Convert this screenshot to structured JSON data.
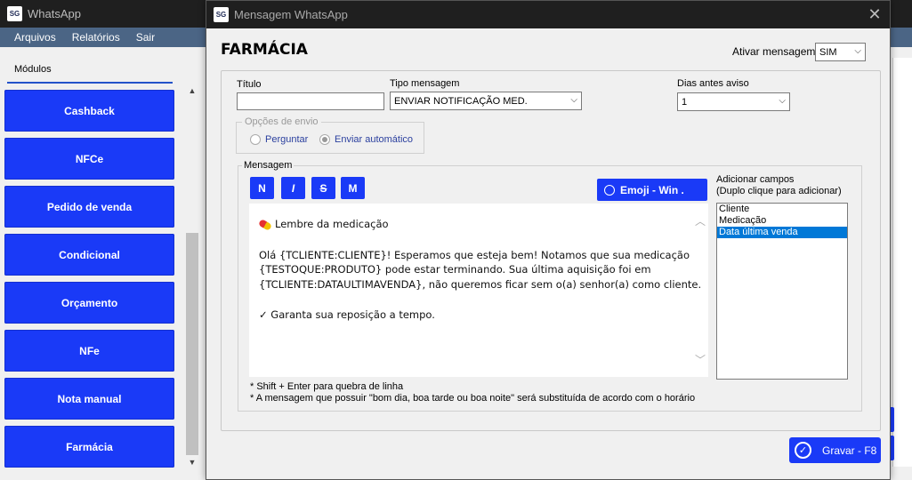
{
  "main_window": {
    "logo": "SG",
    "title": "WhatsApp",
    "menu": [
      "Arquivos",
      "Relatórios",
      "Sair"
    ],
    "modules_tab": "Módulos",
    "modules": [
      "Cashback",
      "NFCe",
      "Pedido de venda",
      "Condicional",
      "Orçamento",
      "NFe",
      "Nota manual",
      "Farmácia"
    ]
  },
  "dialog": {
    "logo": "SG",
    "title": "Mensagem WhatsApp",
    "heading": "FARMÁCIA",
    "ativar_label": "Ativar mensagem",
    "ativar_value": "SIM",
    "titulo_label": "Título",
    "titulo_value": "",
    "tipo_label": "Tipo mensagem",
    "tipo_value": "ENVIAR NOTIFICAÇÃO MED.",
    "dias_label": "Dias antes aviso",
    "dias_value": "1",
    "opcoes_legend": "Opções de envio",
    "opcao_perguntar": "Perguntar",
    "opcao_enviar": "Enviar automático",
    "mensagem_legend": "Mensagem",
    "fmt_buttons": [
      "N",
      "I",
      "S",
      "M"
    ],
    "emoji_button": "Emoji - Win .",
    "message_lines": [
      "Lembre da medicação",
      "Olá {TCLIENTE:CLIENTE}! Esperamos que esteja bem! Notamos que sua medicação",
      "{TESTOQUE:PRODUTO} pode estar terminando. Sua última aquisição foi em",
      "{TCLIENTE:DATAULTIMAVENDA}, não queremos ficar sem o(a) senhor(a) como cliente.",
      "✓ Garanta sua reposição a tempo."
    ],
    "add_fields_label_1": "Adicionar campos",
    "add_fields_label_2": "(Duplo clique para adicionar)",
    "fields": [
      "Cliente",
      "Medicação",
      "Data última venda"
    ],
    "selected_field": "Data última venda",
    "hint_1": "* Shift + Enter para quebra de linha",
    "hint_2": "* A mensagem que possuir \"bom dia, boa tarde ou boa noite\" será substituída de acordo com o horário",
    "gravar_button": "Gravar - F8"
  },
  "colors": {
    "accent": "#1a3af7",
    "titlebar": "#1f1f1f",
    "menubar": "#4b6585",
    "selection": "#0078d7"
  }
}
